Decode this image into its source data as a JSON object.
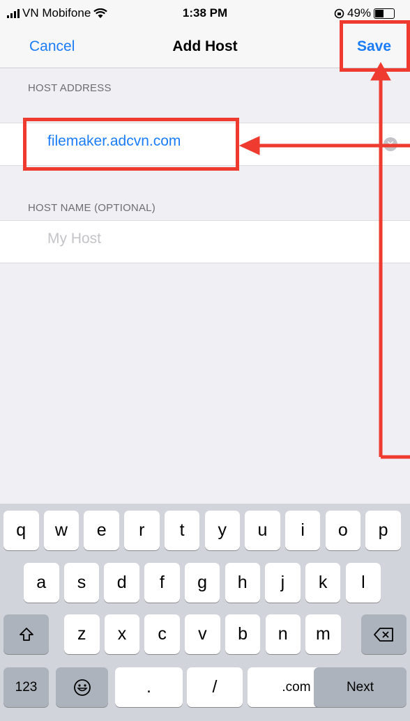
{
  "status_bar": {
    "carrier": "VN Mobifone",
    "wifi_icon": "wifi-icon",
    "time": "1:38 PM",
    "battery_percent": "49%",
    "battery_level": 0.49
  },
  "nav": {
    "cancel_label": "Cancel",
    "title": "Add Host",
    "save_label": "Save"
  },
  "host_address": {
    "header": "HOST ADDRESS",
    "value": "filemaker.adcvn.com"
  },
  "host_name": {
    "header": "HOST NAME (OPTIONAL)",
    "placeholder": "My Host",
    "value": ""
  },
  "keyboard": {
    "row1": [
      "q",
      "w",
      "e",
      "r",
      "t",
      "y",
      "u",
      "i",
      "o",
      "p"
    ],
    "row2": [
      "a",
      "s",
      "d",
      "f",
      "g",
      "h",
      "j",
      "k",
      "l"
    ],
    "row3": [
      "z",
      "x",
      "c",
      "v",
      "b",
      "n",
      "m"
    ],
    "shift_icon": "shift-icon",
    "delete_icon": "delete-icon",
    "numbers_label": "123",
    "emoji_icon": "emoji-icon",
    "dot_label": ".",
    "slash_label": "/",
    "dotcom_label": ".com",
    "next_label": "Next"
  },
  "colors": {
    "accent": "#1a7cf6",
    "annotation": "#ee3a2f"
  }
}
